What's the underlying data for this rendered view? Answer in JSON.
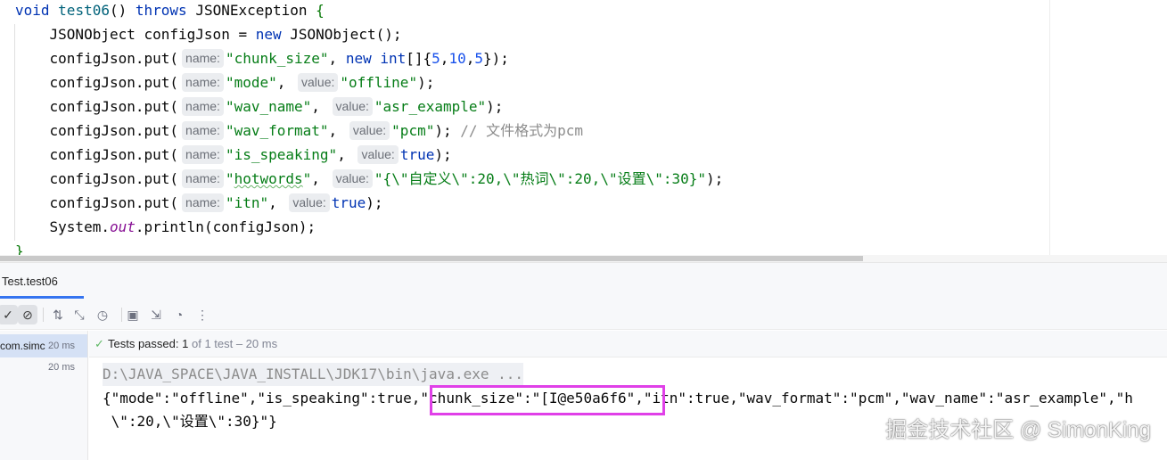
{
  "editor": {
    "lines": [
      {
        "parts": [
          {
            "c": "kw",
            "t": "void "
          },
          {
            "c": "fn",
            "t": "test06"
          },
          {
            "c": "",
            "t": "() "
          },
          {
            "c": "kw",
            "t": "throws "
          },
          {
            "c": "",
            "t": "JSONException "
          },
          {
            "c": "brace-hl",
            "t": "{"
          }
        ]
      },
      {
        "parts": [
          {
            "c": "",
            "t": "    JSONObject configJson = "
          },
          {
            "c": "kw",
            "t": "new "
          },
          {
            "c": "",
            "t": "JSONObject();"
          }
        ]
      },
      {
        "parts": [
          {
            "c": "",
            "t": "    configJson.put("
          },
          {
            "c": "hint",
            "t": "name:"
          },
          {
            "c": "str",
            "t": "\"chunk_size\""
          },
          {
            "c": "",
            "t": ", "
          },
          {
            "c": "kw",
            "t": "new int"
          },
          {
            "c": "",
            "t": "[]{"
          },
          {
            "c": "num",
            "t": "5"
          },
          {
            "c": "",
            "t": ","
          },
          {
            "c": "num",
            "t": "10"
          },
          {
            "c": "",
            "t": ","
          },
          {
            "c": "num",
            "t": "5"
          },
          {
            "c": "",
            "t": "});"
          }
        ]
      },
      {
        "parts": [
          {
            "c": "",
            "t": "    configJson.put("
          },
          {
            "c": "hint",
            "t": "name:"
          },
          {
            "c": "str",
            "t": "\"mode\""
          },
          {
            "c": "",
            "t": ", "
          },
          {
            "c": "hint",
            "t": "value:"
          },
          {
            "c": "str",
            "t": "\"offline\""
          },
          {
            "c": "",
            "t": ");"
          }
        ]
      },
      {
        "parts": [
          {
            "c": "",
            "t": "    configJson.put("
          },
          {
            "c": "hint",
            "t": "name:"
          },
          {
            "c": "str",
            "t": "\"wav_name\""
          },
          {
            "c": "",
            "t": ", "
          },
          {
            "c": "hint",
            "t": "value:"
          },
          {
            "c": "str",
            "t": "\"asr_example\""
          },
          {
            "c": "",
            "t": ");"
          }
        ]
      },
      {
        "parts": [
          {
            "c": "",
            "t": "    configJson.put("
          },
          {
            "c": "hint",
            "t": "name:"
          },
          {
            "c": "str",
            "t": "\"wav_format\""
          },
          {
            "c": "",
            "t": ", "
          },
          {
            "c": "hint",
            "t": "value:"
          },
          {
            "c": "str",
            "t": "\"pcm\""
          },
          {
            "c": "",
            "t": "); "
          },
          {
            "c": "cmt",
            "t": "// 文件格式为pcm"
          }
        ]
      },
      {
        "parts": [
          {
            "c": "",
            "t": "    configJson.put("
          },
          {
            "c": "hint",
            "t": "name:"
          },
          {
            "c": "str",
            "t": "\"is_speaking\""
          },
          {
            "c": "",
            "t": ", "
          },
          {
            "c": "hint",
            "t": "value:"
          },
          {
            "c": "kw",
            "t": "true"
          },
          {
            "c": "",
            "t": ");"
          }
        ]
      },
      {
        "parts": [
          {
            "c": "",
            "t": "    configJson.put("
          },
          {
            "c": "hint",
            "t": "name:"
          },
          {
            "c": "str",
            "t": "\""
          },
          {
            "c": "str typo",
            "t": "hotwords"
          },
          {
            "c": "str",
            "t": "\""
          },
          {
            "c": "",
            "t": ", "
          },
          {
            "c": "hint",
            "t": "value:"
          },
          {
            "c": "str",
            "t": "\"{\\\"自定义\\\":20,\\\"热词\\\":20,\\\"设置\\\":30}\""
          },
          {
            "c": "",
            "t": ");"
          }
        ]
      },
      {
        "parts": [
          {
            "c": "",
            "t": "    configJson.put("
          },
          {
            "c": "hint",
            "t": "name:"
          },
          {
            "c": "str",
            "t": "\"itn\""
          },
          {
            "c": "",
            "t": ", "
          },
          {
            "c": "hint",
            "t": "value:"
          },
          {
            "c": "kw",
            "t": "true"
          },
          {
            "c": "",
            "t": ");"
          }
        ]
      },
      {
        "parts": [
          {
            "c": "",
            "t": "    System."
          },
          {
            "c": "fld",
            "t": "out"
          },
          {
            "c": "",
            "t": ".println(configJson);"
          }
        ]
      },
      {
        "parts": [
          {
            "c": "brace-hl",
            "t": "}"
          }
        ]
      }
    ]
  },
  "run_tab": {
    "label": "Test.test06"
  },
  "toolbar": {
    "buttons": [
      {
        "name": "show-passed-icon",
        "glyph": "✓"
      },
      {
        "name": "show-ignored-icon",
        "glyph": "⊘"
      },
      {
        "name": "sort-icon",
        "glyph": "⇅"
      },
      {
        "name": "collapse-icon",
        "glyph": "⤡"
      },
      {
        "name": "history-icon",
        "glyph": "◷"
      },
      {
        "name": "screenshot-icon",
        "glyph": "▣"
      },
      {
        "name": "import-icon",
        "glyph": "⇲"
      },
      {
        "name": "coverage-icon",
        "glyph": "◔"
      },
      {
        "name": "more-icon",
        "glyph": "⋮"
      }
    ]
  },
  "tree": {
    "rows": [
      {
        "label": "com.simc",
        "time": "20 ms"
      },
      {
        "label": "",
        "time": "20 ms"
      }
    ]
  },
  "status": {
    "passed_label": "Tests passed:",
    "passed_count": "1",
    "detail": "of 1 test – 20 ms"
  },
  "console": {
    "cmd": "D:\\JAVA_SPACE\\JAVA_INSTALL\\JDK17\\bin\\java.exe ...",
    "line1": "{\"mode\":\"offline\",\"is_speaking\":true,\"chunk_size\":\"[I@e50a6f6\",\"itn\":true,\"wav_format\":\"pcm\",\"wav_name\":\"asr_example\",\"h",
    "line2": " \\\":20,\\\"设置\\\":30}\"}"
  },
  "watermark": "掘金技术社区 @ SimonKing",
  "colors": {
    "accent": "#3574f0",
    "highlight_box": "#e040e8",
    "pass_green": "#5fb865"
  }
}
